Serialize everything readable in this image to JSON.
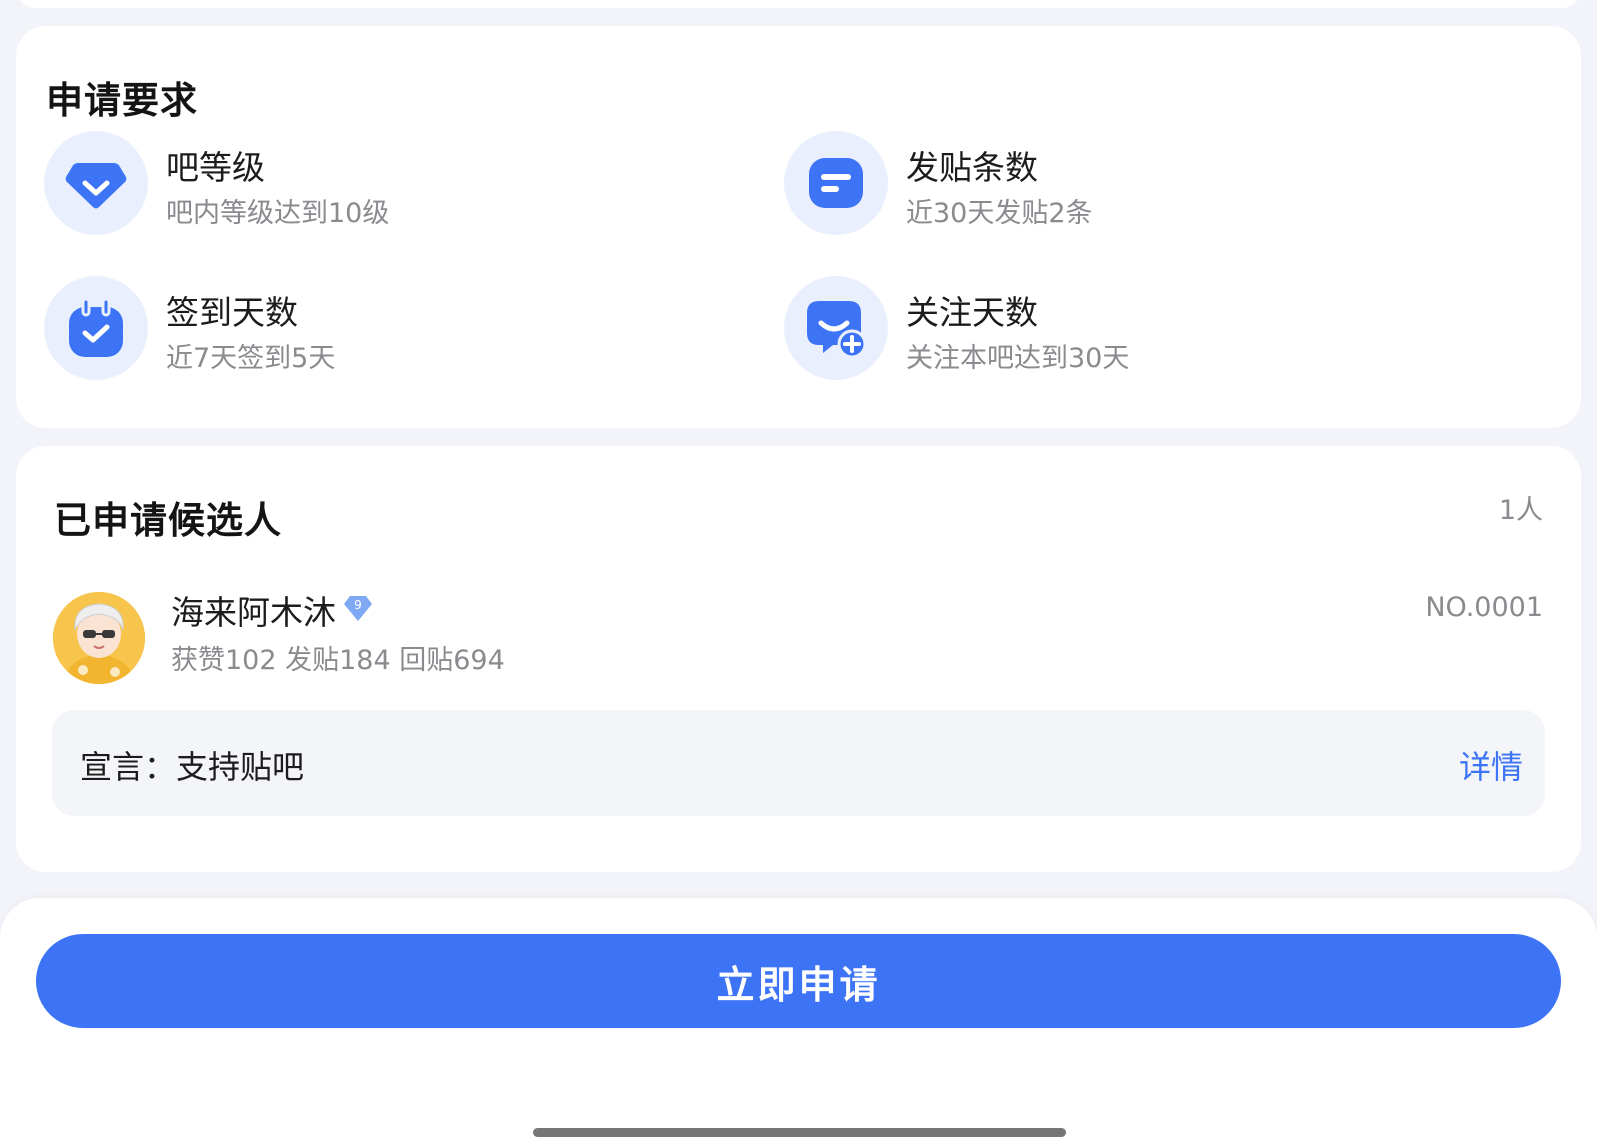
{
  "colors": {
    "accent": "#3d74f6",
    "icon_bg": "#e9effd",
    "card_bg": "#ffffff",
    "page_bg": "#f3f4f9",
    "secondary_text": "#8a8a8f"
  },
  "requirements": {
    "title": "申请要求",
    "items": [
      {
        "icon": "diamond-check-icon",
        "name": "吧等级",
        "desc": "吧内等级达到10级"
      },
      {
        "icon": "post-message-icon",
        "name": "发贴条数",
        "desc": "近30天发贴2条"
      },
      {
        "icon": "calendar-check-icon",
        "name": "签到天数",
        "desc": "近7天签到5天"
      },
      {
        "icon": "follow-add-icon",
        "name": "关注天数",
        "desc": "关注本吧达到30天"
      }
    ]
  },
  "candidates": {
    "title": "已申请候选人",
    "count": "1人",
    "list": [
      {
        "name": "海来阿木沐",
        "level": "9",
        "stats": "获赞102 发贴184 回贴694",
        "number": "NO.0001",
        "manifesto": "宣言：支持贴吧",
        "detail_label": "详情"
      }
    ]
  },
  "footer": {
    "apply_label": "立即申请"
  }
}
